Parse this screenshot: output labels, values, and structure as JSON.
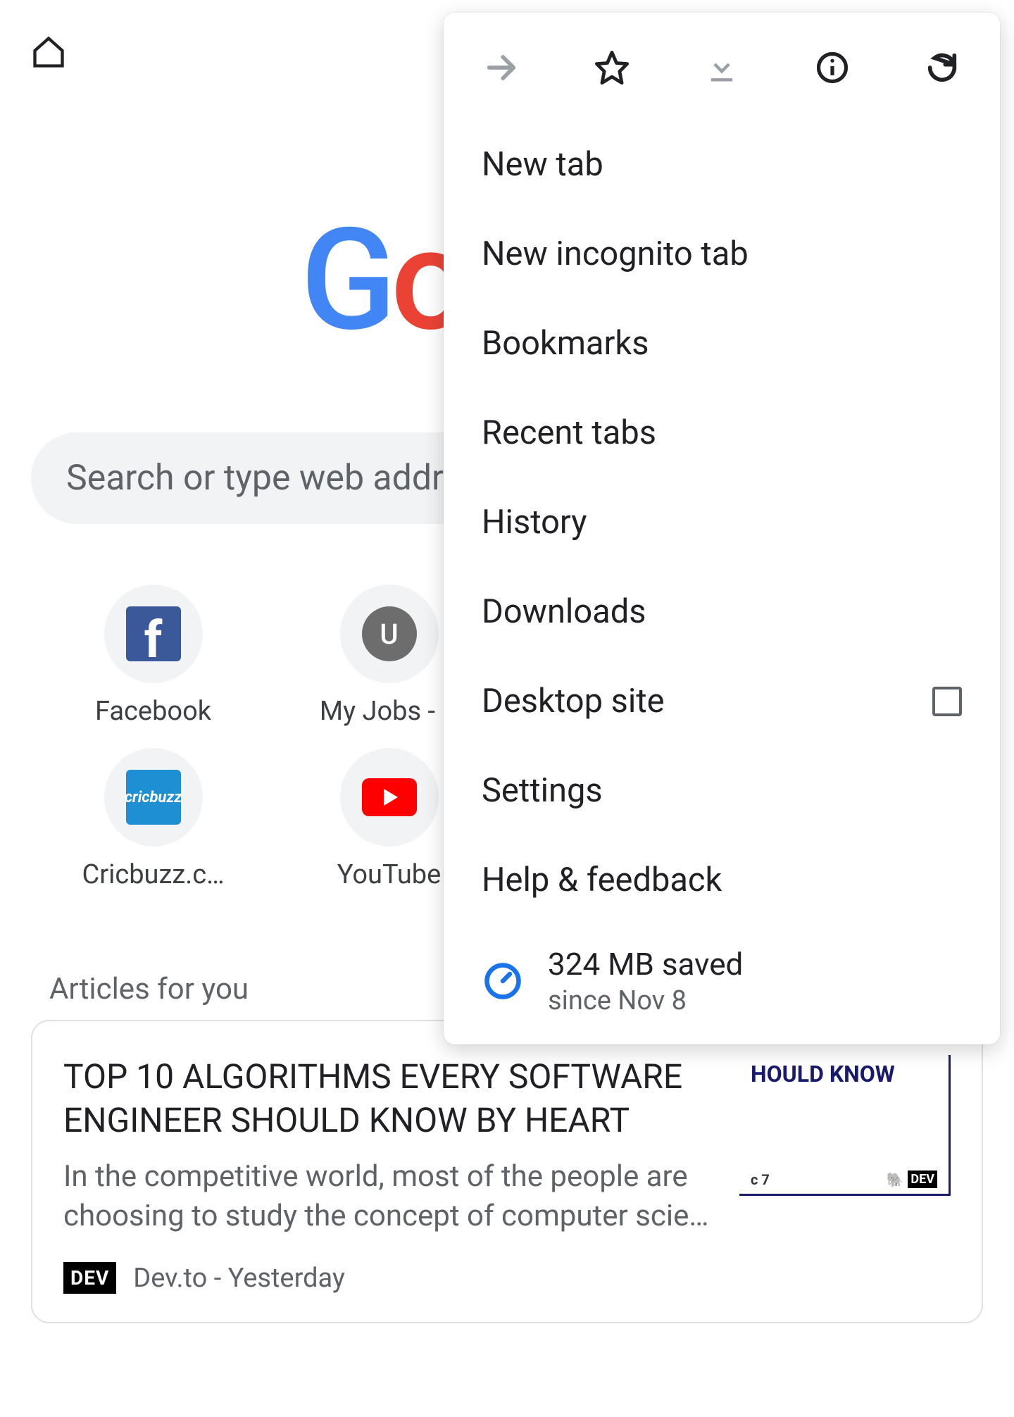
{
  "toolbar": {
    "home": "Home"
  },
  "logo": {
    "text": "Google"
  },
  "search": {
    "placeholder": "Search or type web address"
  },
  "shortcuts": [
    {
      "label": "Facebook",
      "icon": "facebook"
    },
    {
      "label": "My Jobs - B",
      "icon": "letter-u"
    },
    {
      "label": "",
      "icon": ""
    },
    {
      "label": "",
      "icon": ""
    },
    {
      "label": "Cricbuzz.c…",
      "icon": "cricbuzz"
    },
    {
      "label": "YouTube",
      "icon": "youtube"
    },
    {
      "label": "",
      "icon": ""
    },
    {
      "label": "",
      "icon": ""
    }
  ],
  "articles_heading": "Articles for you",
  "article": {
    "title": "TOP 10 ALGORITHMS EVERY SOFTWARE ENGINEER SHOULD KNOW BY HEART",
    "snippet": "In the competitive world, most of the people are choosing to study the concept of computer scie…",
    "thumb_line": "HOULD KNOW",
    "thumb_small": "c 7",
    "source_badge": "DEV",
    "source_line": "Dev.to - Yesterday"
  },
  "menu": {
    "items": {
      "new_tab": "New tab",
      "incognito": "New incognito tab",
      "bookmarks": "Bookmarks",
      "recent": "Recent tabs",
      "history": "History",
      "downloads": "Downloads",
      "desktop": "Desktop site",
      "settings": "Settings",
      "help": "Help & feedback"
    },
    "data_saved": {
      "top": "324 MB saved",
      "bottom": "since Nov 8"
    }
  }
}
